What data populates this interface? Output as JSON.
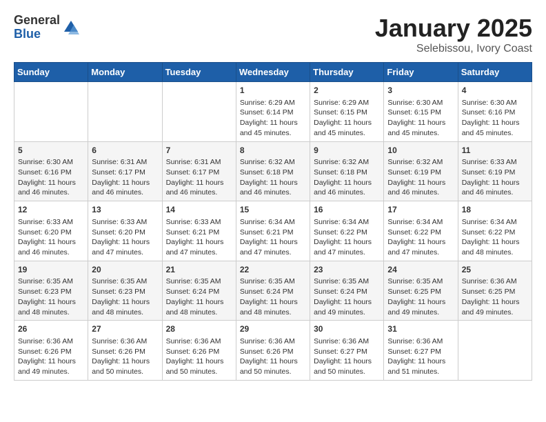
{
  "header": {
    "logo_general": "General",
    "logo_blue": "Blue",
    "title": "January 2025",
    "subtitle": "Selebissou, Ivory Coast"
  },
  "days_of_week": [
    "Sunday",
    "Monday",
    "Tuesday",
    "Wednesday",
    "Thursday",
    "Friday",
    "Saturday"
  ],
  "weeks": [
    [
      {
        "day": "",
        "info": ""
      },
      {
        "day": "",
        "info": ""
      },
      {
        "day": "",
        "info": ""
      },
      {
        "day": "1",
        "info": "Sunrise: 6:29 AM\nSunset: 6:14 PM\nDaylight: 11 hours and 45 minutes."
      },
      {
        "day": "2",
        "info": "Sunrise: 6:29 AM\nSunset: 6:15 PM\nDaylight: 11 hours and 45 minutes."
      },
      {
        "day": "3",
        "info": "Sunrise: 6:30 AM\nSunset: 6:15 PM\nDaylight: 11 hours and 45 minutes."
      },
      {
        "day": "4",
        "info": "Sunrise: 6:30 AM\nSunset: 6:16 PM\nDaylight: 11 hours and 45 minutes."
      }
    ],
    [
      {
        "day": "5",
        "info": "Sunrise: 6:30 AM\nSunset: 6:16 PM\nDaylight: 11 hours and 46 minutes."
      },
      {
        "day": "6",
        "info": "Sunrise: 6:31 AM\nSunset: 6:17 PM\nDaylight: 11 hours and 46 minutes."
      },
      {
        "day": "7",
        "info": "Sunrise: 6:31 AM\nSunset: 6:17 PM\nDaylight: 11 hours and 46 minutes."
      },
      {
        "day": "8",
        "info": "Sunrise: 6:32 AM\nSunset: 6:18 PM\nDaylight: 11 hours and 46 minutes."
      },
      {
        "day": "9",
        "info": "Sunrise: 6:32 AM\nSunset: 6:18 PM\nDaylight: 11 hours and 46 minutes."
      },
      {
        "day": "10",
        "info": "Sunrise: 6:32 AM\nSunset: 6:19 PM\nDaylight: 11 hours and 46 minutes."
      },
      {
        "day": "11",
        "info": "Sunrise: 6:33 AM\nSunset: 6:19 PM\nDaylight: 11 hours and 46 minutes."
      }
    ],
    [
      {
        "day": "12",
        "info": "Sunrise: 6:33 AM\nSunset: 6:20 PM\nDaylight: 11 hours and 46 minutes."
      },
      {
        "day": "13",
        "info": "Sunrise: 6:33 AM\nSunset: 6:20 PM\nDaylight: 11 hours and 47 minutes."
      },
      {
        "day": "14",
        "info": "Sunrise: 6:33 AM\nSunset: 6:21 PM\nDaylight: 11 hours and 47 minutes."
      },
      {
        "day": "15",
        "info": "Sunrise: 6:34 AM\nSunset: 6:21 PM\nDaylight: 11 hours and 47 minutes."
      },
      {
        "day": "16",
        "info": "Sunrise: 6:34 AM\nSunset: 6:22 PM\nDaylight: 11 hours and 47 minutes."
      },
      {
        "day": "17",
        "info": "Sunrise: 6:34 AM\nSunset: 6:22 PM\nDaylight: 11 hours and 47 minutes."
      },
      {
        "day": "18",
        "info": "Sunrise: 6:34 AM\nSunset: 6:22 PM\nDaylight: 11 hours and 48 minutes."
      }
    ],
    [
      {
        "day": "19",
        "info": "Sunrise: 6:35 AM\nSunset: 6:23 PM\nDaylight: 11 hours and 48 minutes."
      },
      {
        "day": "20",
        "info": "Sunrise: 6:35 AM\nSunset: 6:23 PM\nDaylight: 11 hours and 48 minutes."
      },
      {
        "day": "21",
        "info": "Sunrise: 6:35 AM\nSunset: 6:24 PM\nDaylight: 11 hours and 48 minutes."
      },
      {
        "day": "22",
        "info": "Sunrise: 6:35 AM\nSunset: 6:24 PM\nDaylight: 11 hours and 48 minutes."
      },
      {
        "day": "23",
        "info": "Sunrise: 6:35 AM\nSunset: 6:24 PM\nDaylight: 11 hours and 49 minutes."
      },
      {
        "day": "24",
        "info": "Sunrise: 6:35 AM\nSunset: 6:25 PM\nDaylight: 11 hours and 49 minutes."
      },
      {
        "day": "25",
        "info": "Sunrise: 6:36 AM\nSunset: 6:25 PM\nDaylight: 11 hours and 49 minutes."
      }
    ],
    [
      {
        "day": "26",
        "info": "Sunrise: 6:36 AM\nSunset: 6:26 PM\nDaylight: 11 hours and 49 minutes."
      },
      {
        "day": "27",
        "info": "Sunrise: 6:36 AM\nSunset: 6:26 PM\nDaylight: 11 hours and 50 minutes."
      },
      {
        "day": "28",
        "info": "Sunrise: 6:36 AM\nSunset: 6:26 PM\nDaylight: 11 hours and 50 minutes."
      },
      {
        "day": "29",
        "info": "Sunrise: 6:36 AM\nSunset: 6:26 PM\nDaylight: 11 hours and 50 minutes."
      },
      {
        "day": "30",
        "info": "Sunrise: 6:36 AM\nSunset: 6:27 PM\nDaylight: 11 hours and 50 minutes."
      },
      {
        "day": "31",
        "info": "Sunrise: 6:36 AM\nSunset: 6:27 PM\nDaylight: 11 hours and 51 minutes."
      },
      {
        "day": "",
        "info": ""
      }
    ]
  ]
}
